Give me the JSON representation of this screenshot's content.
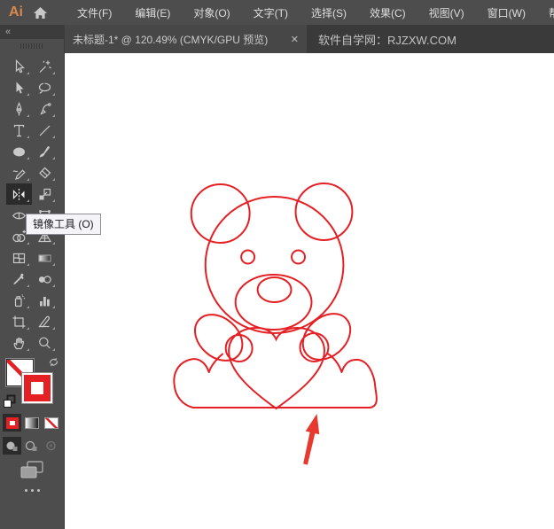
{
  "menubar": {
    "logo": "Ai",
    "items": [
      "文件(F)",
      "编辑(E)",
      "对象(O)",
      "文字(T)",
      "选择(S)",
      "效果(C)",
      "视图(V)",
      "窗口(W)",
      "帮助(H)"
    ]
  },
  "tabbar": {
    "collapse_glyph": "«",
    "document_tab": "未标题-1* @ 120.49% (CMYK/GPU 预览)",
    "close_glyph": "✕",
    "promo": "软件自学网：RJZXW.COM"
  },
  "tooltip": {
    "text": "镜像工具 (O)"
  },
  "toolbar": {
    "selected_tool": "reflect-tool",
    "tools": [
      "selection",
      "magic-wand",
      "direct-selection",
      "lasso",
      "pen",
      "curvature",
      "type",
      "line-segment",
      "ellipse",
      "paintbrush",
      "shaper",
      "eraser",
      "reflect",
      "scale",
      "width",
      "free-transform",
      "shape-builder",
      "perspective-grid",
      "mesh",
      "gradient",
      "eyedropper",
      "blend",
      "symbol-sprayer",
      "column-graph",
      "artboard",
      "slice",
      "hand",
      "zoom"
    ]
  },
  "canvas": {
    "artwork": "teddy-bear-heart-outline"
  },
  "colors": {
    "accent-red": "#E42025",
    "arrow-red": "#E8392F",
    "menubar-bg": "#4D4D4D",
    "tabbar-bg": "#3A3A3A",
    "tab-bg": "#474747",
    "panel-bg": "#4D4D4D",
    "tool-selected-bg": "#2B2B2B",
    "icon-gray": "#C9C9C9",
    "text-light": "#DEDEDE",
    "logo-orange": "#D9884C",
    "canvas-bg": "#FFFFFF",
    "tooltip-bg": "#F4F4F9",
    "tooltip-border": "#8E8E98"
  }
}
